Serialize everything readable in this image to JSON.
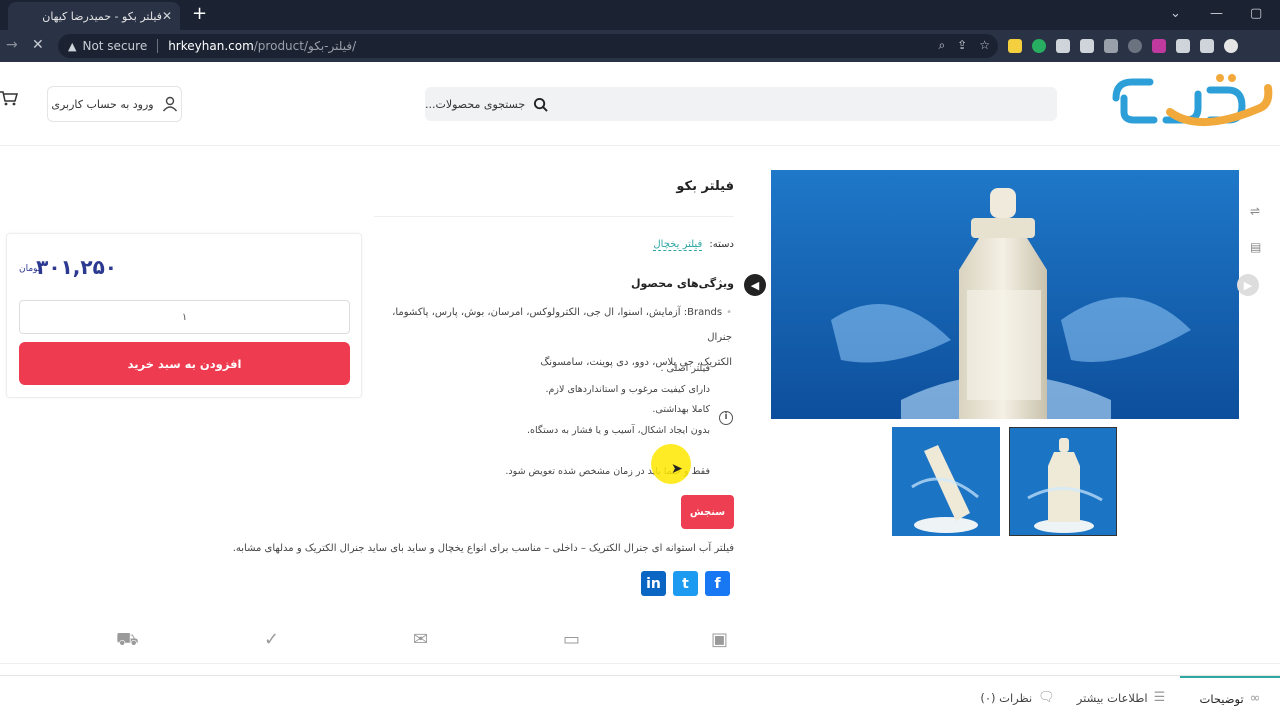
{
  "browser": {
    "tab_title": "فیلتر بکو - حمیدرضا کیهان",
    "tab_close": "✕",
    "new_tab": "+",
    "not_secure": "Not secure",
    "url_domain": "hrkeyhan.com",
    "url_path": "/product/فیلتر-بکو/"
  },
  "header": {
    "logo_text": "کیهان",
    "search_placeholder": "جستجوی محصولات...",
    "login_label": "ورود به حساب کاربری"
  },
  "product": {
    "title": "فیلتر بکو",
    "category_label": "دسته:",
    "category_link": "فیلتر یخچال",
    "features_title": "ویژگی‌های محصول",
    "brands_line1": "Brands: آزمایش، اسنوا، ال جی، الکترولوکس، امرسان، بوش، پارس، پاکشوما، جنرال",
    "brands_line2": "الکتریک، جی پلاس، دوو، دی پوینت، سامسونگ",
    "features": [
      "فیلتر اصلی .",
      "دارای کیفیت مرغوب و استانداردهای لازم.",
      "کاملا بهداشتی.",
      "بدون ایجاد اشکال، آسیب و یا فشار به دستگاه.",
      "فقط و حتما باید در زمان مشخص شده تعویض شود."
    ],
    "info_icon": "i",
    "measure_button": "سنجش",
    "description": "فیلتر آب استوانه ای جنرال الکتریک – داخلی –  مناسب برای انواع یخچال و ساید بای ساید جنرال الکتریک و مدلهای مشابه."
  },
  "purchase": {
    "price": "۳۰۱,۲۵۰",
    "currency": "تومان",
    "quantity": "۱",
    "add_to_cart": "افزودن به سبد خرید"
  },
  "social": {
    "facebook": "f",
    "twitter": "t",
    "linkedin": "in"
  },
  "tabs": [
    {
      "label": "توضیحات"
    },
    {
      "label": "اطلاعات بیشتر"
    },
    {
      "label": "نظرات (۰)"
    }
  ],
  "colors": {
    "accent_red": "#ef3b50",
    "price_blue": "#2c3990",
    "teal": "#2ea8a4"
  }
}
